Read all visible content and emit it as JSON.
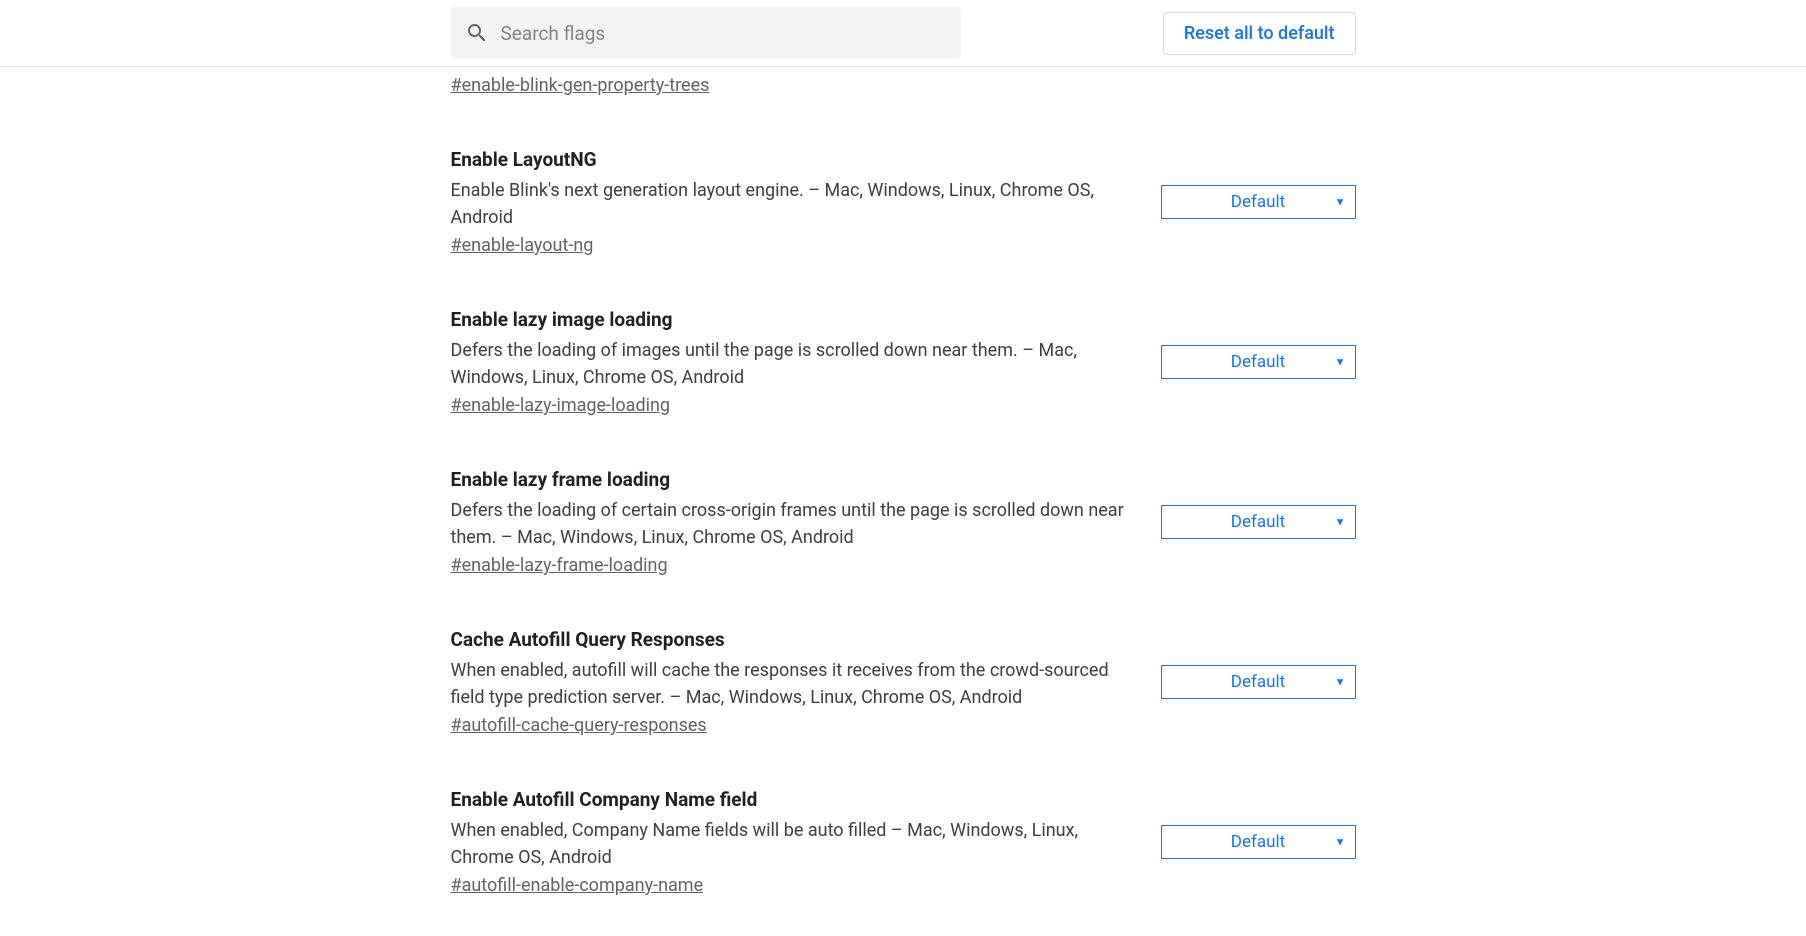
{
  "header": {
    "search_placeholder": "Search flags",
    "reset_label": "Reset all to default"
  },
  "orphan_link": "#enable-blink-gen-property-trees",
  "select_value": "Default",
  "flags": [
    {
      "title": "Enable LayoutNG",
      "desc": "Enable Blink's next generation layout engine. – Mac, Windows, Linux, Chrome OS, Android",
      "link": "#enable-layout-ng"
    },
    {
      "title": "Enable lazy image loading",
      "desc": "Defers the loading of images until the page is scrolled down near them. – Mac, Windows, Linux, Chrome OS, Android",
      "link": "#enable-lazy-image-loading"
    },
    {
      "title": "Enable lazy frame loading",
      "desc": "Defers the loading of certain cross-origin frames until the page is scrolled down near them. – Mac, Windows, Linux, Chrome OS, Android",
      "link": "#enable-lazy-frame-loading"
    },
    {
      "title": "Cache Autofill Query Responses",
      "desc": "When enabled, autofill will cache the responses it receives from the crowd-sourced field type prediction server. – Mac, Windows, Linux, Chrome OS, Android",
      "link": "#autofill-cache-query-responses"
    },
    {
      "title": "Enable Autofill Company Name field",
      "desc": "When enabled, Company Name fields will be auto filled – Mac, Windows, Linux, Chrome OS, Android",
      "link": "#autofill-enable-company-name"
    }
  ]
}
